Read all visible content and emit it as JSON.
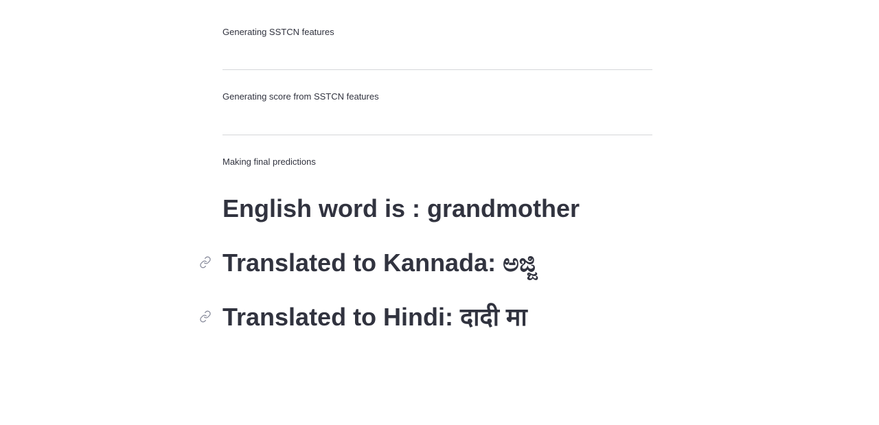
{
  "status_steps": [
    {
      "label": "Generating SSTCN features"
    },
    {
      "label": "Generating score from SSTCN features"
    },
    {
      "label": "Making final predictions"
    }
  ],
  "results": {
    "english_heading": "English word is : grandmother",
    "kannada_heading": "Translated to Kannada: ಅಜ್ಜಿ",
    "hindi_heading": "Translated to Hindi: दादी मा"
  },
  "icons": {
    "anchor": "link-icon"
  }
}
